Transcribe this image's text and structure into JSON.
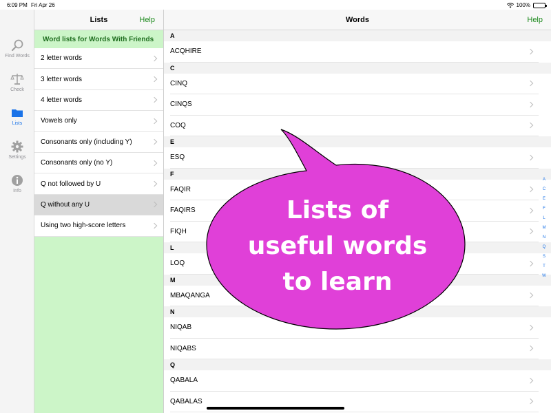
{
  "status": {
    "time": "6:09 PM",
    "date": "Fri Apr 26",
    "battery": "100%"
  },
  "rail": {
    "items": [
      {
        "label": "Find Words",
        "icon": "magnifier-icon"
      },
      {
        "label": "Check",
        "icon": "scales-icon"
      },
      {
        "label": "Lists",
        "icon": "folder-icon",
        "active": true
      },
      {
        "label": "Settings",
        "icon": "gear-icon"
      },
      {
        "label": "Info",
        "icon": "info-icon"
      }
    ]
  },
  "lists": {
    "title": "Lists",
    "help": "Help",
    "header": "Word lists for Words With Friends",
    "items": [
      "2 letter words",
      "3 letter words",
      "4 letter words",
      "Vowels only",
      "Consonants only (including Y)",
      "Consonants only (no Y)",
      "Q not followed by U",
      "Q without any U",
      "Using two high-score letters"
    ],
    "selected_index": 7
  },
  "words": {
    "title": "Words",
    "help": "Help",
    "sections": [
      {
        "letter": "A",
        "words": [
          "ACQHIRE"
        ]
      },
      {
        "letter": "C",
        "words": [
          "CINQ",
          "CINQS",
          "COQ"
        ]
      },
      {
        "letter": "E",
        "words": [
          "ESQ"
        ]
      },
      {
        "letter": "F",
        "words": [
          "FAQIR",
          "FAQIRS",
          "FIQH"
        ]
      },
      {
        "letter": "L",
        "words": [
          "LOQ"
        ]
      },
      {
        "letter": "M",
        "words": [
          "MBAQANGA"
        ]
      },
      {
        "letter": "N",
        "words": [
          "NIQAB",
          "NIQABS"
        ]
      },
      {
        "letter": "Q",
        "words": [
          "QABALA",
          "QABALAS"
        ]
      }
    ],
    "index": [
      "A",
      "C",
      "E",
      "F",
      "L",
      "M",
      "N",
      "Q",
      "S",
      "T",
      "W"
    ]
  },
  "bubble": {
    "lines": [
      "Lists of",
      "useful words",
      "to learn"
    ],
    "fill": "#e040d8",
    "stroke": "#000000",
    "text_color": "#ffffff"
  },
  "colors": {
    "accent_green": "#1e8a1e",
    "list_bg": "#ccf5c8",
    "index_blue": "#1a73e8"
  }
}
